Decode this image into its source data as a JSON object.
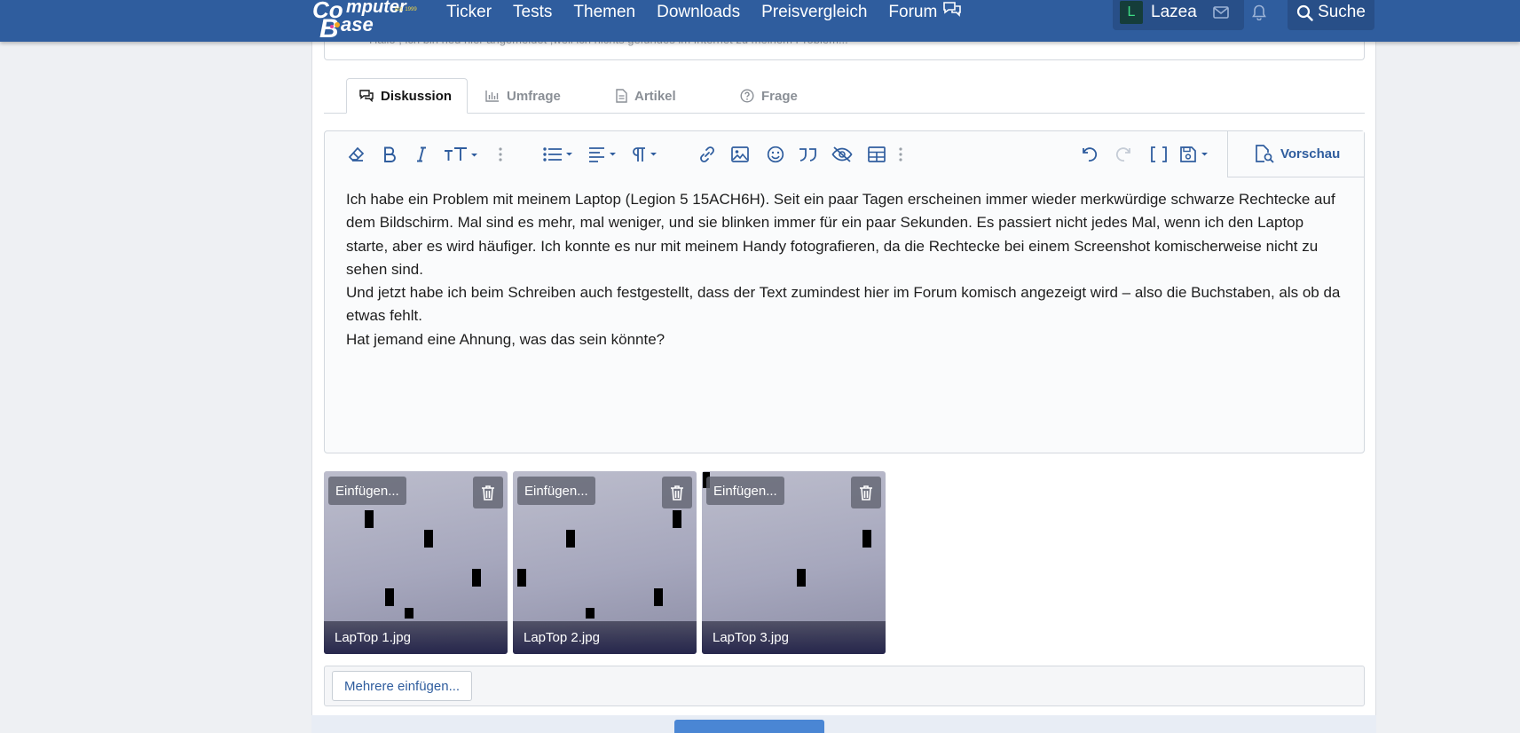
{
  "header": {
    "logo_text": "ComputerBase",
    "logo_est": "est. 1999",
    "nav": [
      "Ticker",
      "Tests",
      "Themen",
      "Downloads",
      "Preisvergleich",
      "Forum"
    ],
    "user_initial": "L",
    "username": "Lazea",
    "search_label": "Suche"
  },
  "previous_post_snippet": "Hallo , ich bin neu hier angemeldet ,weil ich nichts gefundes im Internet zu meinem Problem...",
  "tabs": {
    "discussion": "Diskussion",
    "poll": "Umfrage",
    "article": "Artikel",
    "question": "Frage"
  },
  "editor": {
    "preview_label": "Vorschau",
    "paragraphs": [
      "Ich habe ein Problem mit meinem Laptop (Legion 5 15ACH6H). Seit ein paar Tagen erscheinen immer wieder merkwürdige schwarze Rechtecke auf dem Bildschirm. Mal sind es mehr, mal weniger, und sie blinken immer für ein paar Sekunden. Es passiert nicht jedes Mal, wenn ich den Laptop starte, aber es wird häufiger. Ich konnte es nur mit meinem Handy fotografieren, da die Rechtecke bei einem Screenshot komischerweise nicht zu sehen sind.",
      "Und jetzt habe ich beim Schreiben auch festgestellt, dass der  Text zumindest hier im Forum komisch angezeigt wird – also die Buchstaben, als ob da etwas fehlt.",
      "Hat jemand eine Ahnung, was das sein könnte?"
    ]
  },
  "attachments": [
    {
      "insert_label": "Einfügen...",
      "filename": "LapTop 1.jpg"
    },
    {
      "insert_label": "Einfügen...",
      "filename": "LapTop 2.jpg"
    },
    {
      "insert_label": "Einfügen...",
      "filename": "LapTop 3.jpg"
    }
  ],
  "insert_multiple_label": "Mehrere einfügen...",
  "colors": {
    "header_bg": "#2f5d9e",
    "accent": "#2f5d9e",
    "avatar_bg": "#153d3a",
    "avatar_fg": "#3ddc84"
  }
}
